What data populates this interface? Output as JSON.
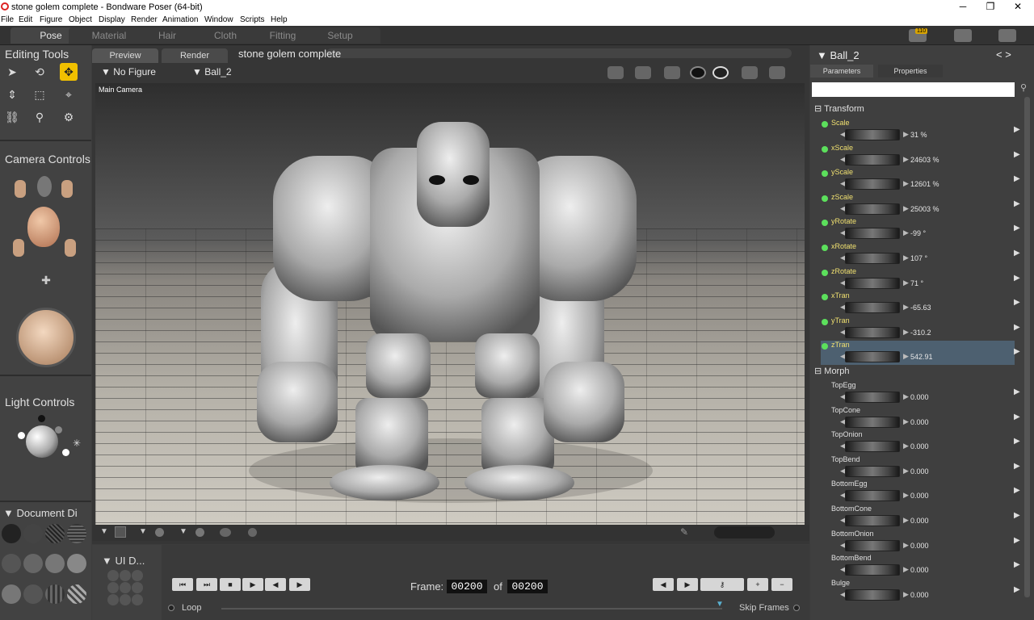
{
  "window": {
    "title": "stone golem complete - Bondware Poser (64-bit)"
  },
  "menu": [
    "File",
    "Edit",
    "Figure",
    "Object",
    "Display",
    "Render",
    "Animation",
    "Window",
    "Scripts",
    "Help"
  ],
  "rooms": [
    "Pose",
    "Material",
    "Hair",
    "Cloth",
    "Fitting",
    "Setup"
  ],
  "notifications": {
    "count": "110"
  },
  "left": {
    "editing_title": "Editing Tools",
    "camera_title": "Camera Controls",
    "light_title": "Light Controls",
    "document_title": "Document",
    "document_suffix": "Di",
    "ui_title": "UI D..."
  },
  "viewport": {
    "tabs": [
      "Preview",
      "Render"
    ],
    "doc_title": "stone golem complete",
    "figure": "No Figure",
    "actor": "Ball_2",
    "camera": "Main Camera"
  },
  "animation": {
    "frame_label": "Frame:",
    "of_label": "of",
    "current": "00200",
    "total": "00200",
    "loop": "Loop",
    "skip": "Skip Frames"
  },
  "right": {
    "title": "Ball_2",
    "tabs": [
      "Parameters",
      "Properties"
    ],
    "transform_title": "Transform",
    "morph_title": "Morph",
    "transform": [
      {
        "name": "Scale",
        "value": "31 %"
      },
      {
        "name": "xScale",
        "value": "24603 %"
      },
      {
        "name": "yScale",
        "value": "12601 %"
      },
      {
        "name": "zScale",
        "value": "25003 %"
      },
      {
        "name": "yRotate",
        "value": "-99 °"
      },
      {
        "name": "xRotate",
        "value": "107 °"
      },
      {
        "name": "zRotate",
        "value": "71 °"
      },
      {
        "name": "xTran",
        "value": "-65.63"
      },
      {
        "name": "yTran",
        "value": "-310.2"
      },
      {
        "name": "zTran",
        "value": "542.91"
      }
    ],
    "morph": [
      {
        "name": "TopEgg",
        "value": "0.000"
      },
      {
        "name": "TopCone",
        "value": "0.000"
      },
      {
        "name": "TopOnion",
        "value": "0.000"
      },
      {
        "name": "TopBend",
        "value": "0.000"
      },
      {
        "name": "BottomEgg",
        "value": "0.000"
      },
      {
        "name": "BottomCone",
        "value": "0.000"
      },
      {
        "name": "BottomOnion",
        "value": "0.000"
      },
      {
        "name": "BottomBend",
        "value": "0.000"
      },
      {
        "name": "Bulge",
        "value": "0.000"
      }
    ]
  },
  "colors": {
    "accent": "#f0c000",
    "selected_row": "#4d6070",
    "led": "#5ce05c",
    "transform_text": "#f0e070",
    "morph_text": "#e0e0e0"
  }
}
